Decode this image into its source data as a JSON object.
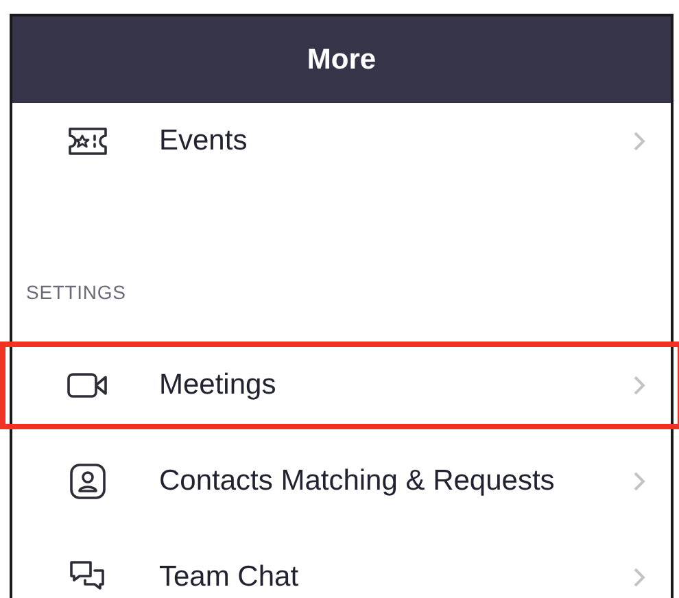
{
  "header": {
    "title": "More"
  },
  "top_items": [
    {
      "label": "Events",
      "highlighted": false
    }
  ],
  "settings": {
    "heading": "SETTINGS",
    "items": [
      {
        "label": "Meetings",
        "highlighted": true
      },
      {
        "label": "Contacts Matching & Requests",
        "highlighted": false
      },
      {
        "label": "Team Chat",
        "highlighted": false
      }
    ]
  }
}
